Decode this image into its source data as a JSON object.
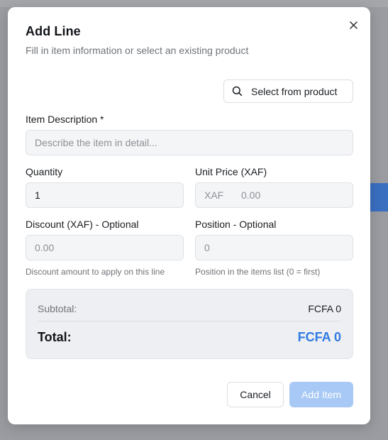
{
  "dialog": {
    "title": "Add Line",
    "subtitle": "Fill in item information or select an existing product",
    "close_icon": "close-icon",
    "select_product_label": "Select from product",
    "select_product_icon": "search-icon"
  },
  "form": {
    "description": {
      "label": "Item Description *",
      "placeholder": "Describe the item in detail...",
      "value": ""
    },
    "quantity": {
      "label": "Quantity",
      "value": "1"
    },
    "unit_price": {
      "label": "Unit Price (XAF)",
      "prefix": "XAF",
      "placeholder": "0.00",
      "value": ""
    },
    "discount": {
      "label": "Discount (XAF) - Optional",
      "placeholder": "0.00",
      "value": "",
      "hint": "Discount amount to apply on this line"
    },
    "position": {
      "label": "Position - Optional",
      "placeholder": "0",
      "value": "",
      "hint": "Position in the items list (0 = first)"
    }
  },
  "summary": {
    "subtotal_label": "Subtotal:",
    "subtotal_value": "FCFA 0",
    "total_label": "Total:",
    "total_value": "FCFA 0"
  },
  "actions": {
    "cancel_label": "Cancel",
    "add_label": "Add Item"
  },
  "colors": {
    "accent": "#2f7ae5",
    "primary_button_disabled": "#a8c9f5"
  }
}
